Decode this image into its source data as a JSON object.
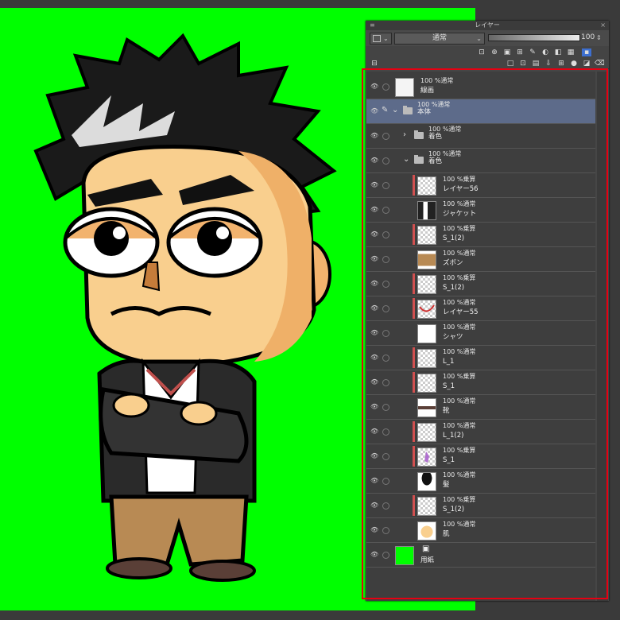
{
  "panel": {
    "title": "レイヤー",
    "menu_icon": "≡",
    "close_icon": "×"
  },
  "props": {
    "blend_mode": "通常",
    "opacity": "100",
    "chevron": "⌄",
    "spin": "⇕"
  },
  "layers": [
    {
      "mode": "100 %通常",
      "name": "線画",
      "indent": 0,
      "kind": "layer",
      "thumb": "lineart"
    },
    {
      "mode": "100 %通常",
      "name": "本体",
      "indent": 0,
      "kind": "folder",
      "expanded": true,
      "selected": true
    },
    {
      "mode": "100 %通常",
      "name": "着色",
      "indent": 1,
      "kind": "folder",
      "expanded": false
    },
    {
      "mode": "100 %通常",
      "name": "着色",
      "indent": 1,
      "kind": "folder",
      "expanded": true
    },
    {
      "mode": "100 %乗算",
      "name": "レイヤー56",
      "indent": 2,
      "kind": "layer",
      "clip": true,
      "thumb": "check"
    },
    {
      "mode": "100 %通常",
      "name": "ジャケット",
      "indent": 2,
      "kind": "layer",
      "thumb": "jacket"
    },
    {
      "mode": "100 %乗算",
      "name": "S_1(2)",
      "indent": 2,
      "kind": "layer",
      "clip": true,
      "thumb": "check"
    },
    {
      "mode": "100 %通常",
      "name": "ズボン",
      "indent": 2,
      "kind": "layer",
      "thumb": "pants"
    },
    {
      "mode": "100 %乗算",
      "name": "S_1(2)",
      "indent": 2,
      "kind": "layer",
      "clip": true,
      "thumb": "check"
    },
    {
      "mode": "100 %通常",
      "name": "レイヤー55",
      "indent": 2,
      "kind": "layer",
      "clip": true,
      "thumb": "redline"
    },
    {
      "mode": "100 %通常",
      "name": "シャツ",
      "indent": 2,
      "kind": "layer",
      "thumb": "white"
    },
    {
      "mode": "100 %通常",
      "name": "L_1",
      "indent": 2,
      "kind": "layer",
      "clip": true,
      "thumb": "check"
    },
    {
      "mode": "100 %乗算",
      "name": "S_1",
      "indent": 2,
      "kind": "layer",
      "clip": true,
      "thumb": "check"
    },
    {
      "mode": "100 %通常",
      "name": "靴",
      "indent": 2,
      "kind": "layer",
      "thumb": "shoes"
    },
    {
      "mode": "100 %通常",
      "name": "L_1(2)",
      "indent": 2,
      "kind": "layer",
      "clip": true,
      "thumb": "check"
    },
    {
      "mode": "100 %乗算",
      "name": "S_1",
      "indent": 2,
      "kind": "layer",
      "clip": true,
      "thumb": "purple"
    },
    {
      "mode": "100 %通常",
      "name": "髪",
      "indent": 2,
      "kind": "layer",
      "thumb": "hair"
    },
    {
      "mode": "100 %乗算",
      "name": "S_1(2)",
      "indent": 2,
      "kind": "layer",
      "clip": true,
      "thumb": "check"
    },
    {
      "mode": "100 %通常",
      "name": "肌",
      "indent": 2,
      "kind": "layer",
      "thumb": "skin"
    },
    {
      "mode": "",
      "name": "用紙",
      "indent": 0,
      "kind": "paper",
      "thumb": "green"
    }
  ],
  "icons": {
    "eye": "eye-icon",
    "paper_symbol": "▣"
  },
  "colors": {
    "canvas": "#00ff00",
    "highlight": "#e60012",
    "selected_row": "#5d6b8a",
    "clip_mark": "#d05050"
  }
}
